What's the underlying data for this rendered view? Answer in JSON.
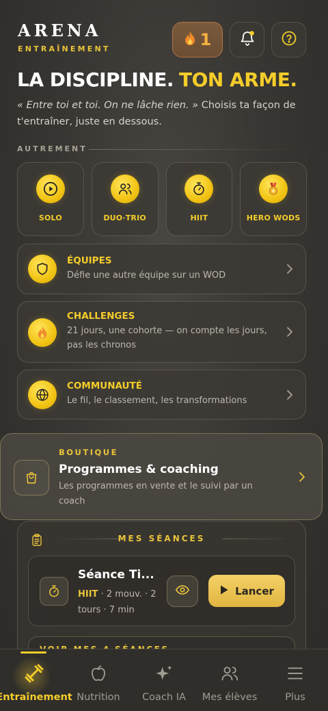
{
  "brand": {
    "title": "ARENA",
    "subtitle": "ENTRAÎNEMENT"
  },
  "header": {
    "streak_count": "1",
    "icons": [
      "flame-icon",
      "bell-icon",
      "help-icon"
    ],
    "bell_has_badge": true
  },
  "hero": {
    "part1": "LA DISCIPLINE.",
    "part2": "TON ARME.",
    "quote": "« Entre toi et toi. On ne lâche rien. »",
    "tagline": "Choisis ta façon de t'entraîner, juste en dessous."
  },
  "section_label": "AUTREMENT",
  "modes": [
    {
      "label": "SOLO",
      "icon": "play-icon"
    },
    {
      "label": "DUO·TRIO",
      "icon": "users-icon"
    },
    {
      "label": "HIIT",
      "icon": "stopwatch-icon"
    },
    {
      "label": "HERO WODS",
      "icon": "medal-icon"
    }
  ],
  "rows": [
    {
      "title": "ÉQUIPES",
      "subtitle": "Défie une autre équipe sur un WOD",
      "icon": "shield-icon"
    },
    {
      "title": "CHALLENGES",
      "subtitle": "21 jours, une cohorte — on compte les jours, pas les chronos",
      "icon": "flame-icon"
    },
    {
      "title": "COMMUNAUTÉ",
      "subtitle": "Le fil, le classement, les transformations",
      "icon": "globe-icon"
    }
  ],
  "shop": {
    "kicker": "BOUTIQUE",
    "title": "Programmes & coaching",
    "subtitle": "Les programmes en vente et le suivi par un coach"
  },
  "sessions": {
    "header": "MES SÉANCES",
    "card": {
      "title": "Séance Ti...",
      "type": "HIIT",
      "meta": " · 2 mouv. · 2 tours · 7 min",
      "launch_label": "Lancer"
    },
    "see_all": "VOIR MES 4 SÉANCES"
  },
  "tabs": [
    {
      "label": "Entraînement",
      "icon": "dumbbell-icon",
      "active": true
    },
    {
      "label": "Nutrition",
      "icon": "apple-icon",
      "active": false
    },
    {
      "label": "Coach IA",
      "icon": "sparkles-icon",
      "active": false
    },
    {
      "label": "Mes élèves",
      "icon": "users-icon",
      "active": false
    },
    {
      "label": "Plus",
      "icon": "menu-icon",
      "active": false
    }
  ],
  "colors": {
    "accent": "#f4cd2a",
    "background": "#393733",
    "streak": "#f5b042"
  }
}
